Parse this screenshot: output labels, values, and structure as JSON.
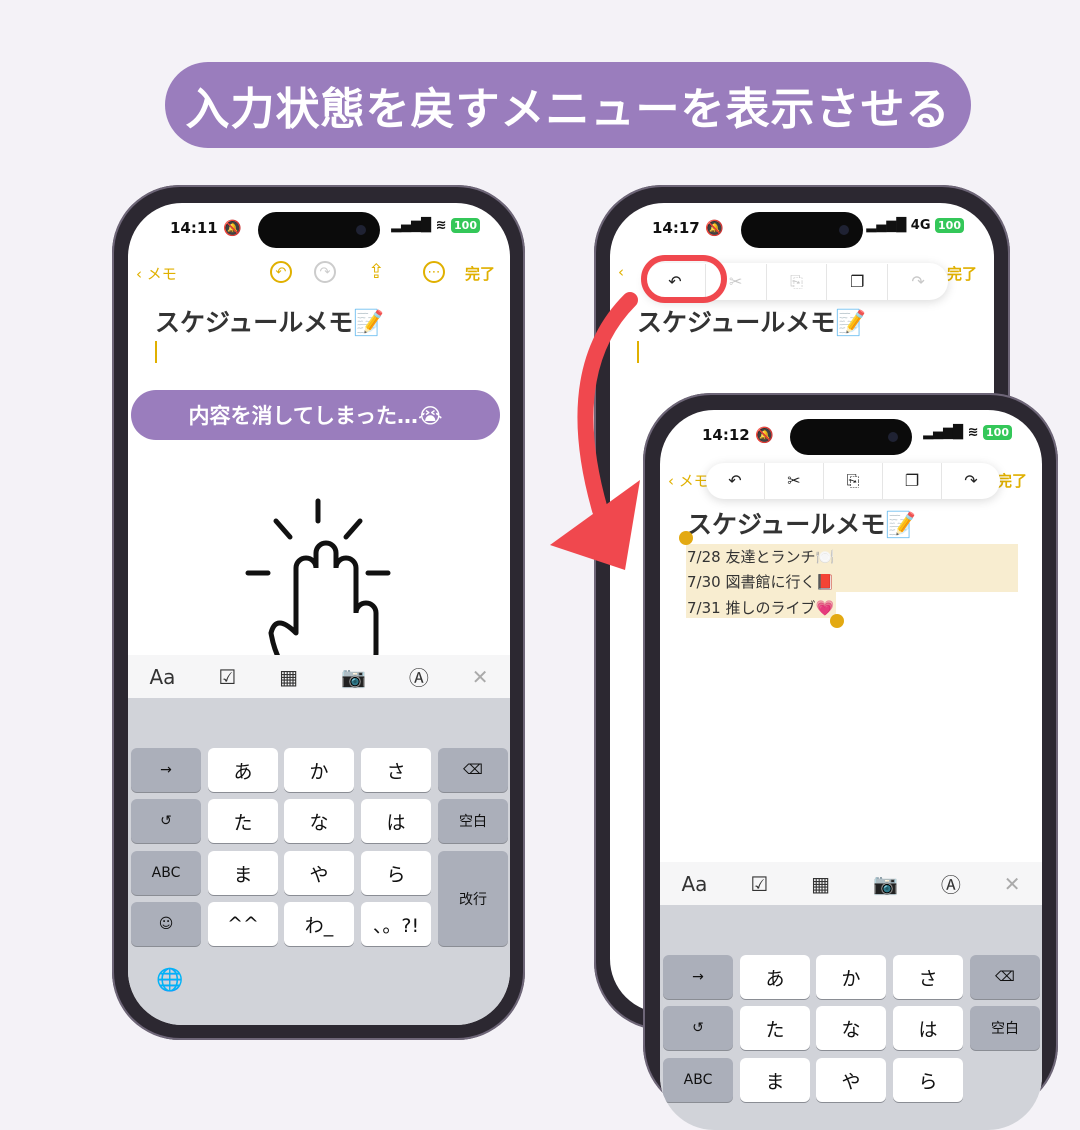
{
  "heading": "入力状態を戻すメニューを表示させる",
  "callout": "内容を消してしまった…😭",
  "colors": {
    "accent_purple": "#9a7dbd",
    "notes_yellow": "#e0b000",
    "highlight_red": "#f0484e",
    "battery_green": "#34c759"
  },
  "phone_left": {
    "time": "14:11",
    "network": "",
    "battery": "100",
    "nav": {
      "back_label": "メモ",
      "done_label": "完了",
      "icons": [
        "undo-icon",
        "redo-icon",
        "share-icon",
        "more-icon"
      ]
    },
    "note_title": "スケジュールメモ📝",
    "toolbar": [
      "Aa",
      "checklist-icon",
      "table-icon",
      "camera-icon",
      "markup-icon",
      "close-icon"
    ],
    "gesture_icon": "three-finger-tap-icon",
    "keyboard": {
      "rows": [
        [
          "→",
          "あ",
          "か",
          "さ",
          "⌫"
        ],
        [
          "↺",
          "た",
          "な",
          "は",
          "空白"
        ],
        [
          "ABC",
          "ま",
          "や",
          "ら",
          "改行"
        ],
        [
          "☺",
          "^^",
          "わ_",
          "、。?!"
        ]
      ],
      "globe": "🌐"
    }
  },
  "phone_back": {
    "time": "14:17",
    "network": "4G",
    "battery": "100",
    "nav": {
      "done_label": "完了"
    },
    "note_title": "スケジュールメモ📝",
    "menu": [
      "↶",
      "✂",
      "⎘",
      "❐",
      "↷"
    ]
  },
  "phone_front": {
    "time": "14:12",
    "network": "",
    "battery": "100",
    "nav": {
      "back_label": "メモ",
      "done_label": "完了"
    },
    "note_title": "スケジュールメモ📝",
    "menu": [
      "↶",
      "✂",
      "⎘",
      "❐",
      "↷"
    ],
    "lines": [
      "7/28 友達とランチ🍽️",
      "7/30 図書館に行く📕",
      "7/31 推しのライブ💗"
    ],
    "toolbar": [
      "Aa",
      "checklist-icon",
      "table-icon",
      "camera-icon",
      "markup-icon",
      "close-icon"
    ],
    "keyboard": {
      "rows": [
        [
          "→",
          "あ",
          "か",
          "さ",
          "⌫"
        ],
        [
          "↺",
          "た",
          "な",
          "は",
          "空白"
        ],
        [
          "ABC",
          "ま",
          "や",
          "ら"
        ]
      ]
    }
  }
}
